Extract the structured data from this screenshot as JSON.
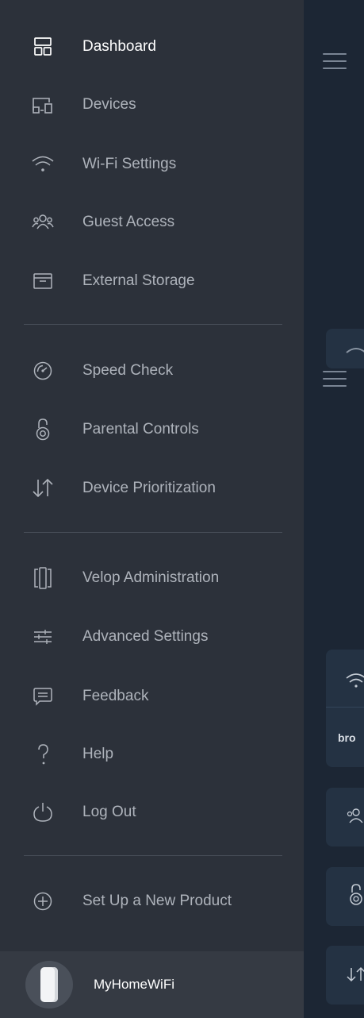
{
  "menu": {
    "dashboard": "Dashboard",
    "devices": "Devices",
    "wifi_settings": "Wi-Fi Settings",
    "guest_access": "Guest Access",
    "external_storage": "External Storage",
    "speed_check": "Speed Check",
    "parental_controls": "Parental Controls",
    "device_prioritization": "Device Prioritization",
    "velop_administration": "Velop Administration",
    "advanced_settings": "Advanced Settings",
    "feedback": "Feedback",
    "help": "Help",
    "log_out": "Log Out",
    "set_up_new_product": "Set Up a New Product"
  },
  "footer": {
    "network_name": "MyHomeWiFi"
  },
  "background": {
    "partial_text": "bro"
  },
  "icons": {
    "dashboard": "dashboard-grid-icon",
    "devices": "devices-icon",
    "wifi_settings": "wifi-icon",
    "guest_access": "guests-icon",
    "external_storage": "storage-box-icon",
    "speed_check": "speedometer-icon",
    "parental_controls": "lock-icon",
    "device_prioritization": "priority-arrows-icon",
    "velop_administration": "velop-node-icon",
    "advanced_settings": "sliders-icon",
    "feedback": "chat-bubble-icon",
    "help": "question-icon",
    "log_out": "power-icon",
    "set_up_new_product": "plus-circle-icon"
  },
  "colors": {
    "drawer_bg": "#2c313a",
    "footer_bg": "#353a43",
    "app_bg": "#1c2634",
    "card_bg": "#243243",
    "label": "#aeb3bb",
    "active_label": "#ffffff"
  }
}
